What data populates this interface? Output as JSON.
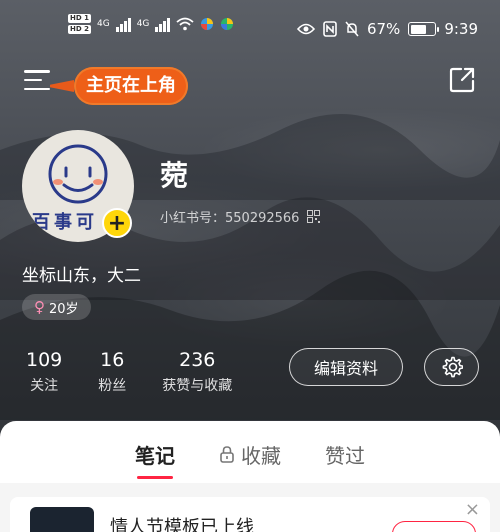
{
  "status_bar": {
    "hd_top": "HD 1",
    "hd_bottom": "HD 2",
    "net1": "4G",
    "net2": "4G",
    "battery": "67%",
    "time": "9:39"
  },
  "header": {
    "banner_label": "主页在上角"
  },
  "profile": {
    "username": "菀",
    "id_label": "小红书号：550292566",
    "bio": "坐标山东，大二",
    "age": "20岁",
    "avatar_text": "百事可"
  },
  "stats": [
    {
      "num": "109",
      "label": "关注"
    },
    {
      "num": "16",
      "label": "粉丝"
    },
    {
      "num": "236",
      "label": "获赞与收藏"
    }
  ],
  "actions": {
    "edit_label": "编辑资料"
  },
  "tabs": [
    {
      "label": "笔记",
      "active": true
    },
    {
      "label": "收藏",
      "active": false
    },
    {
      "label": "赞过",
      "active": false
    }
  ],
  "feed": {
    "card_title": "情人节模板已上线",
    "card_close": "×"
  },
  "colors": {
    "accent": "#ff2442",
    "banner": "#ee5f18",
    "plus": "#ffd60a"
  }
}
